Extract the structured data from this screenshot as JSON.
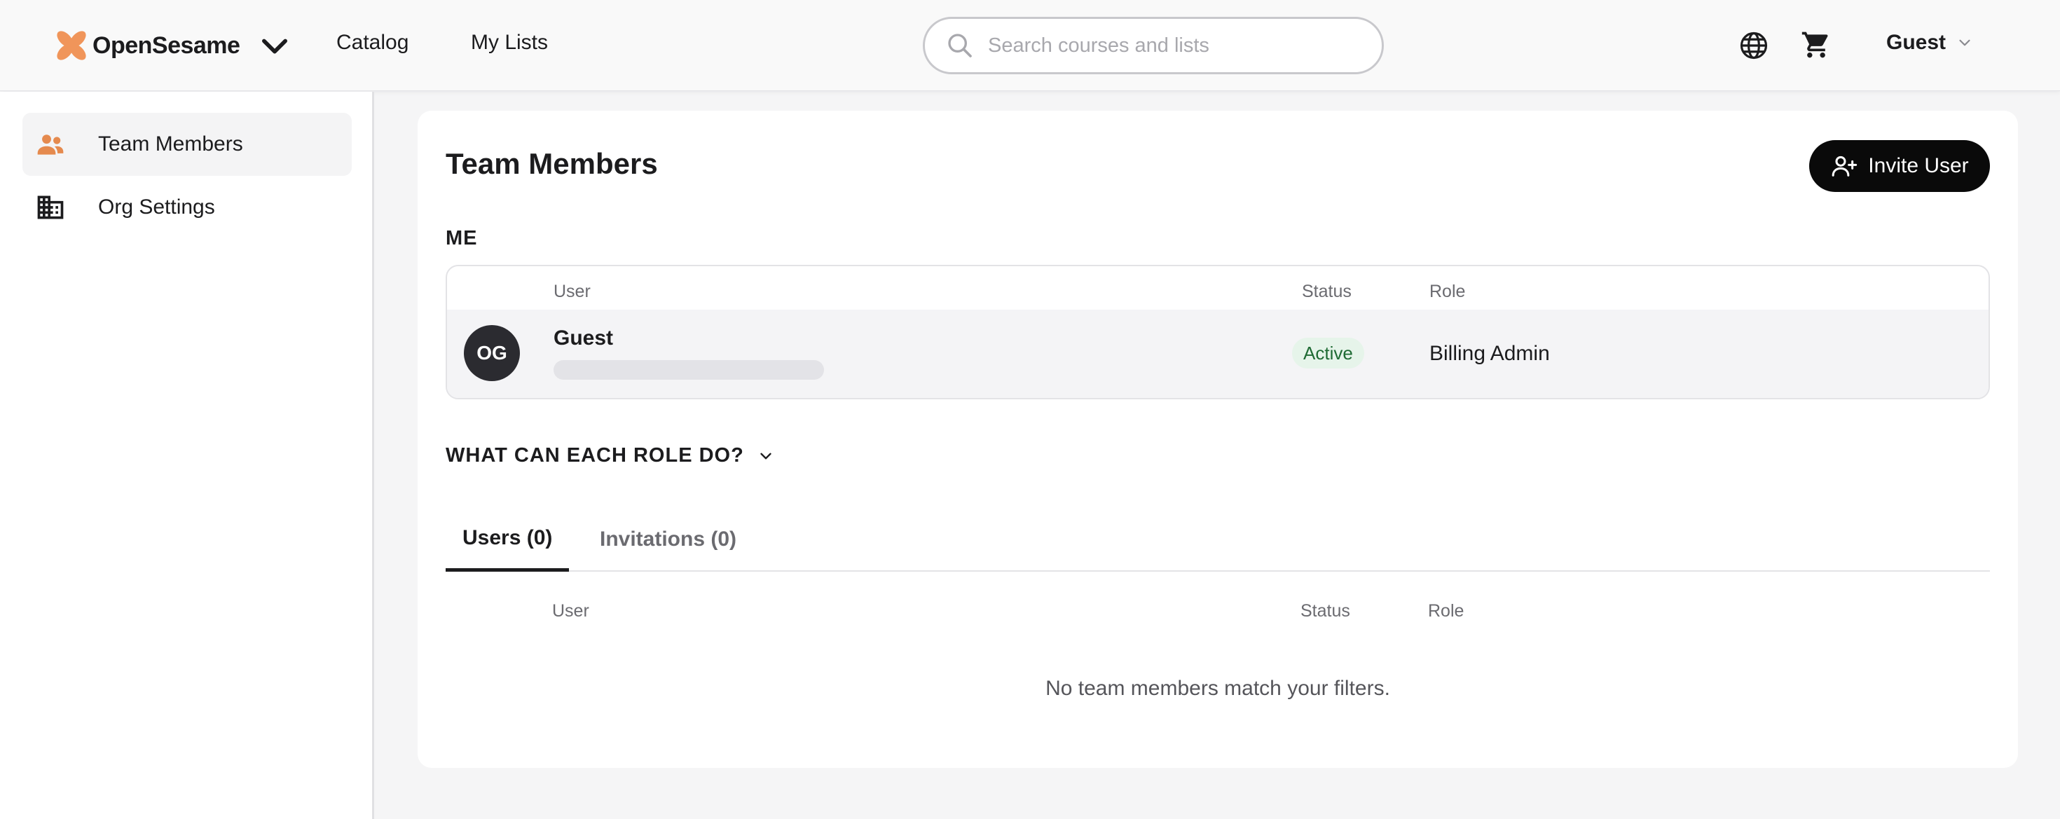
{
  "header": {
    "brand": "OpenSesame",
    "nav": {
      "catalog": "Catalog",
      "my_lists": "My Lists"
    },
    "search": {
      "placeholder": "Search courses and lists",
      "value": ""
    },
    "user": "Guest"
  },
  "sidebar": {
    "items": [
      {
        "label": "Team Members",
        "icon": "people-icon",
        "active": true
      },
      {
        "label": "Org Settings",
        "icon": "building-icon",
        "active": false
      }
    ]
  },
  "main": {
    "title": "Team Members",
    "invite_label": "Invite User",
    "me_section": "ME",
    "columns": {
      "user": "User",
      "status": "Status",
      "role": "Role"
    },
    "me": {
      "initials": "OG",
      "name": "Guest",
      "status": "Active",
      "role": "Billing Admin"
    },
    "roles_toggle": "WHAT CAN EACH ROLE DO?",
    "tabs": [
      {
        "label": "Users (0)"
      },
      {
        "label": "Invitations (0)"
      }
    ],
    "empty": "No team members match your filters."
  },
  "colors": {
    "brand": "#f0955a",
    "badge_bg": "#e6f4ea",
    "badge_text": "#1f6b34"
  }
}
